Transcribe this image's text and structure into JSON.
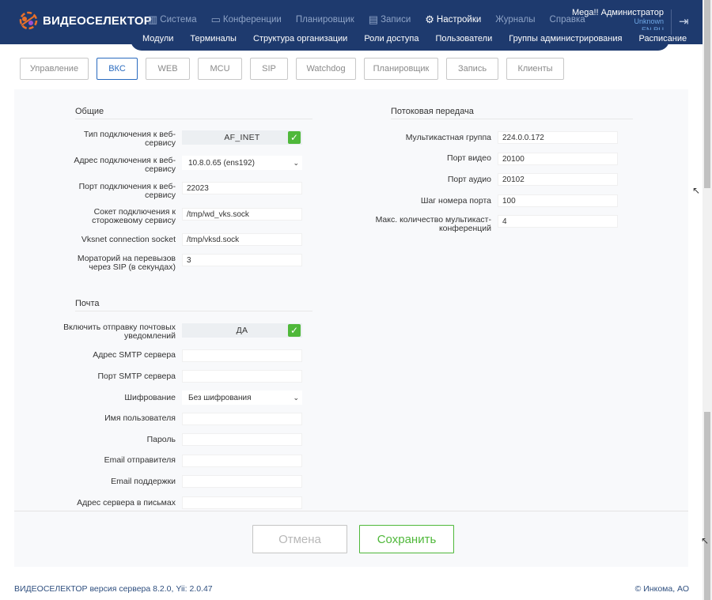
{
  "header": {
    "logo_text": "ВИДЕОСЕЛЕКТОР",
    "nav": [
      {
        "label": "Система",
        "icon": "bar-chart-icon",
        "active": false
      },
      {
        "label": "Конференции",
        "icon": "chat-icon",
        "active": false
      },
      {
        "label": "Планировщик",
        "icon": "",
        "active": false
      },
      {
        "label": "Записи",
        "icon": "film-icon",
        "active": false
      },
      {
        "label": "Настройки",
        "icon": "gears-icon",
        "active": true
      },
      {
        "label": "Журналы",
        "icon": "",
        "active": false
      },
      {
        "label": "Справка",
        "icon": "",
        "active": false
      }
    ],
    "user": {
      "name": "Mega!! Администратор",
      "line2": "Unknown",
      "line3": "EN RU"
    },
    "subnav": [
      "Модули",
      "Терминалы",
      "Структура организации",
      "Роли доступа",
      "Пользователи",
      "Группы администрирования",
      "Расписание"
    ]
  },
  "tabs": [
    "Управление",
    "ВКС",
    "WEB",
    "MCU",
    "SIP",
    "Watchdog",
    "Планировщик",
    "Запись",
    "Клиенты"
  ],
  "active_tab": "ВКС",
  "general": {
    "title": "Общие",
    "conn_type_label": "Тип подключения к веб-сервису",
    "conn_type_value": "AF_INET",
    "conn_addr_label": "Адрес подключения к веб-сервису",
    "conn_addr_value": "10.8.0.65 (ens192)",
    "conn_port_label": "Порт подключения к веб-сервису",
    "conn_port_value": "22023",
    "socket_label": "Сокет подключения к сторожевому сервису",
    "socket_value": "/tmp/wd_vks.sock",
    "vksnet_label": "Vksnet connection socket",
    "vksnet_value": "/tmp/vksd.sock",
    "moratorium_label": "Мораторий на перевызов через SIP (в секундах)",
    "moratorium_value": "3"
  },
  "streaming": {
    "title": "Потоковая передача",
    "mcast_group_label": "Мультикастная группа",
    "mcast_group_value": "224.0.0.172",
    "video_port_label": "Порт видео",
    "video_port_value": "20100",
    "audio_port_label": "Порт аудио",
    "audio_port_value": "20102",
    "port_step_label": "Шаг номера порта",
    "port_step_value": "100",
    "max_conf_label": "Макс. количество мультикаст-конференций",
    "max_conf_value": "4"
  },
  "mail": {
    "title": "Почта",
    "enable_label": "Включить отправку почтовых уведомлений",
    "enable_value": "ДА",
    "smtp_addr_label": "Адрес SMTP сервера",
    "smtp_addr_value": "",
    "smtp_port_label": "Порт SMTP сервера",
    "smtp_port_value": "",
    "encryption_label": "Шифрование",
    "encryption_value": "Без шифрования",
    "username_label": "Имя пользователя",
    "username_value": "",
    "password_label": "Пароль",
    "password_value": "",
    "sender_label": "Email отправителя",
    "sender_value": "",
    "support_label": "Email поддержки",
    "support_value": "",
    "server_addr_label": "Адрес сервера в письмах",
    "server_addr_value": ""
  },
  "actions": {
    "cancel": "Отмена",
    "save": "Сохранить"
  },
  "footer": {
    "left": "ВИДЕОСЕЛЕКТОР версия сервера 8.2.0, Yii: 2.0.47",
    "right": "© Инкома, АО"
  },
  "colors": {
    "header_bg": "#1e3a6e",
    "accent_blue": "#2a6bbf",
    "accent_green": "#4fb83a"
  }
}
